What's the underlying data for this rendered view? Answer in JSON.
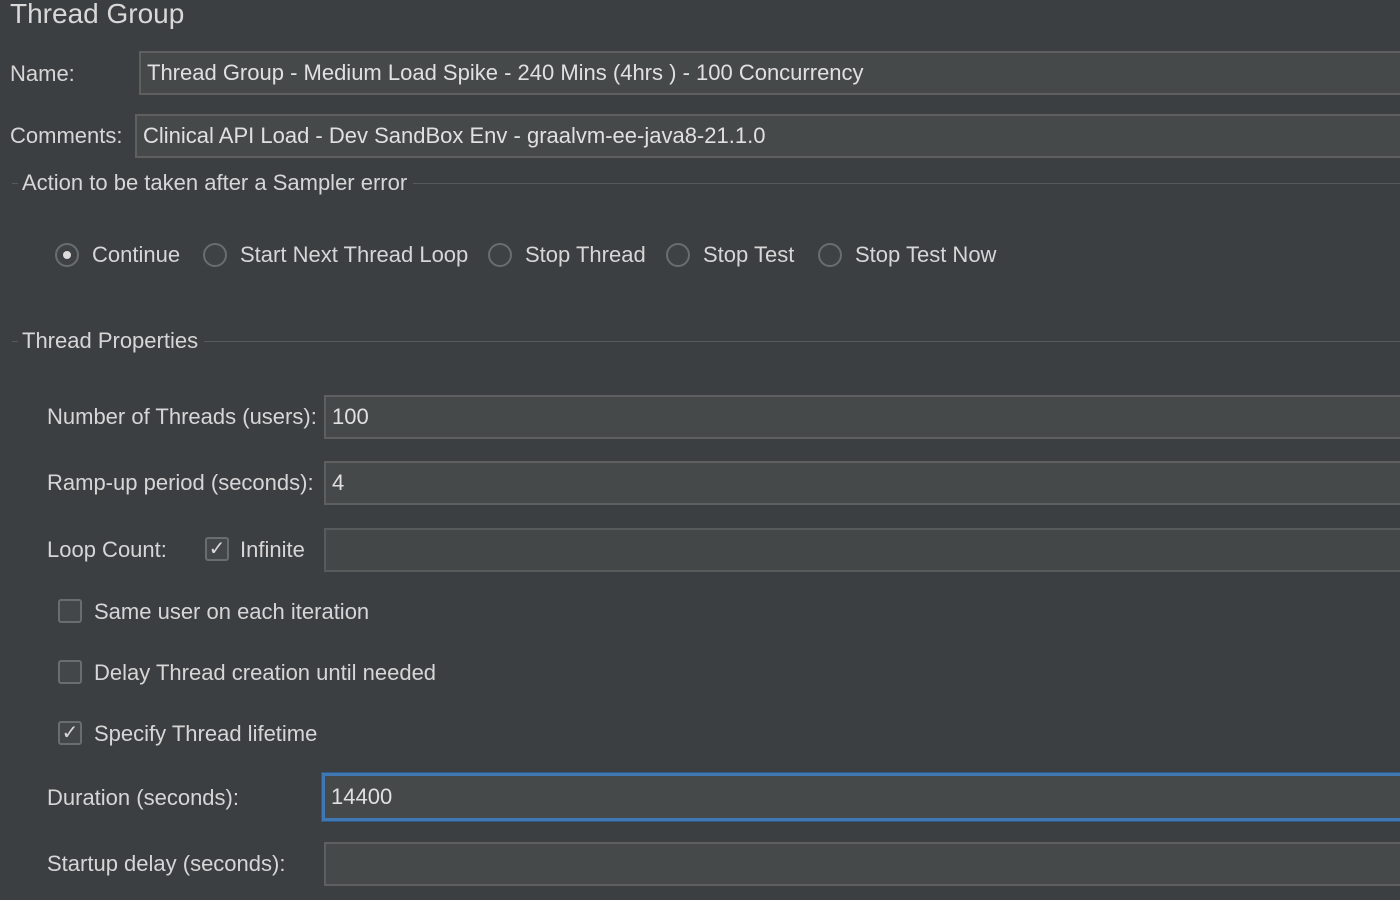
{
  "panel": {
    "title": "Thread Group"
  },
  "name": {
    "label": "Name:",
    "value": "Thread Group - Medium Load Spike - 240 Mins (4hrs ) - 100 Concurrency"
  },
  "comments": {
    "label": "Comments:",
    "value": "Clinical API Load - Dev SandBox Env - graalvm-ee-java8-21.1.0"
  },
  "sampler_error": {
    "title": "Action to be taken after a Sampler error",
    "options": [
      {
        "label": "Continue",
        "selected": true
      },
      {
        "label": "Start Next Thread Loop",
        "selected": false
      },
      {
        "label": "Stop Thread",
        "selected": false
      },
      {
        "label": "Stop Test",
        "selected": false
      },
      {
        "label": "Stop Test Now",
        "selected": false
      }
    ]
  },
  "thread_properties": {
    "title": "Thread Properties",
    "num_threads": {
      "label": "Number of Threads (users):",
      "value": "100"
    },
    "ramp_up": {
      "label": "Ramp-up period (seconds):",
      "value": "4"
    },
    "loop_count": {
      "label": "Loop Count:",
      "infinite_label": "Infinite",
      "infinite_checked": true,
      "value": ""
    },
    "same_user": {
      "label": "Same user on each iteration",
      "checked": false
    },
    "delay_thread": {
      "label": "Delay Thread creation until needed",
      "checked": false
    },
    "specify_lifetime": {
      "label": "Specify Thread lifetime",
      "checked": true
    },
    "duration": {
      "label": "Duration (seconds):",
      "value": "14400"
    },
    "startup_delay": {
      "label": "Startup delay (seconds):",
      "value": ""
    }
  },
  "glyphs": {
    "check": "✓"
  }
}
